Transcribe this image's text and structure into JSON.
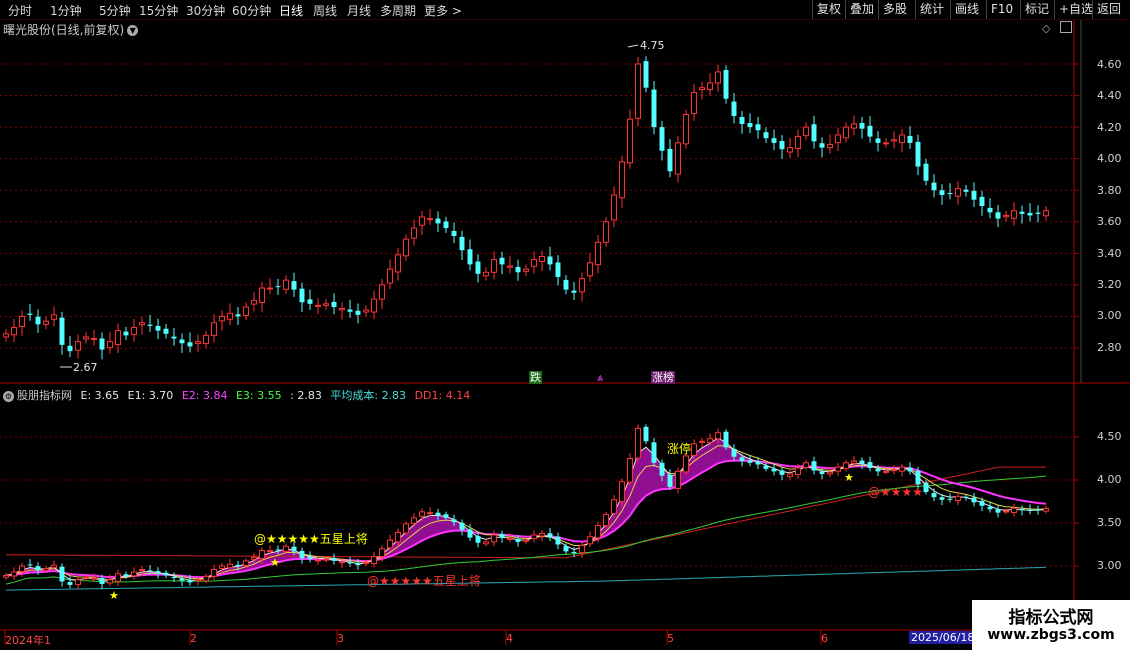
{
  "toolbar": {
    "periods": [
      "分时",
      "1分钟",
      "5分钟",
      "15分钟",
      "30分钟",
      "60分钟",
      "日线",
      "周线",
      "月线",
      "多周期",
      "更多 >"
    ],
    "active_period": "日线",
    "buttons": [
      "复权",
      "叠加",
      "多股",
      "统计",
      "画线",
      "F10",
      "标记",
      "+自选",
      "返回"
    ]
  },
  "main_chart": {
    "title": "曙光股份(日线,前复权)",
    "y_ticks": [
      "4.60",
      "4.40",
      "4.20",
      "4.00",
      "3.80",
      "3.60",
      "3.40",
      "3.20",
      "3.00",
      "2.80"
    ],
    "high_label": "4.75",
    "low_label": "2.67",
    "event_labels": {
      "fall": "跌",
      "up_arrow": "⩓",
      "limit_list": "涨榜"
    }
  },
  "indicator": {
    "name": "股朋指标网",
    "values": [
      {
        "label": "E:",
        "value": "3.65",
        "color": "#e6e6e6"
      },
      {
        "label": "E1:",
        "value": "3.70",
        "color": "#e6e6e6"
      },
      {
        "label": "E2:",
        "value": "3.84",
        "color": "#ff44ff"
      },
      {
        "label": "E3:",
        "value": "3.55",
        "color": "#44ff44"
      },
      {
        "label": ":",
        "value": "2.83",
        "color": "#e6e6e6"
      },
      {
        "label": "平均成本:",
        "value": "2.83",
        "color": "#44dddd"
      },
      {
        "label": "DD1:",
        "value": "4.14",
        "color": "#ff4444"
      }
    ],
    "y_ticks": [
      "4.50",
      "4.00",
      "3.50",
      "3.00"
    ],
    "signal_five_star_top": "@★★★★★五星上将",
    "signal_five_star_bottom": "@★★★★★五星上将",
    "signal_stars_right": "@★★★★",
    "limit_up_label": "涨停"
  },
  "x_axis": {
    "labels": [
      "2024年1",
      "2",
      "3",
      "4",
      "5",
      "6"
    ],
    "cursor_date": "2025/06/18"
  },
  "watermark": {
    "line1": "指标公式网",
    "line2": "www.zbgs3.com"
  },
  "colors": {
    "up": "#ff3333",
    "down": "#54ffff",
    "grid": "#7a0000",
    "axis": "#b00000"
  },
  "chart_data": {
    "type": "candlestick",
    "y_range": [
      2.55,
      4.85
    ],
    "closes": [
      2.89,
      2.93,
      3.0,
      3.01,
      2.95,
      2.97,
      3.01,
      2.82,
      2.78,
      2.84,
      2.87,
      2.86,
      2.79,
      2.84,
      2.91,
      2.88,
      2.93,
      2.96,
      2.94,
      2.91,
      2.89,
      2.86,
      2.83,
      2.81,
      2.84,
      2.88,
      2.96,
      3.0,
      3.02,
      3.0,
      3.06,
      3.1,
      3.18,
      3.18,
      3.19,
      3.23,
      3.17,
      3.09,
      3.08,
      3.07,
      3.08,
      3.06,
      3.05,
      3.03,
      3.01,
      3.04,
      3.11,
      3.2,
      3.3,
      3.39,
      3.49,
      3.56,
      3.63,
      3.62,
      3.59,
      3.56,
      3.51,
      3.42,
      3.33,
      3.27,
      3.28,
      3.36,
      3.33,
      3.32,
      3.28,
      3.3,
      3.36,
      3.38,
      3.33,
      3.25,
      3.17,
      3.15,
      3.24,
      3.34,
      3.47,
      3.6,
      3.77,
      3.98,
      4.25,
      4.6,
      4.45,
      4.2,
      4.05,
      3.92,
      4.1,
      4.28,
      4.42,
      4.45,
      4.48,
      4.55,
      4.38,
      4.27,
      4.22,
      4.2,
      4.18,
      4.13,
      4.1,
      4.06,
      4.07,
      4.14,
      4.2,
      4.11,
      4.07,
      4.09,
      4.15,
      4.2,
      4.22,
      4.19,
      4.14,
      4.1,
      4.1,
      4.12,
      4.15,
      4.1,
      3.95,
      3.86,
      3.8,
      3.77,
      3.78,
      3.81,
      3.79,
      3.74,
      3.7,
      3.66,
      3.62,
      3.64,
      3.67,
      3.65,
      3.64,
      3.65,
      3.67
    ]
  }
}
